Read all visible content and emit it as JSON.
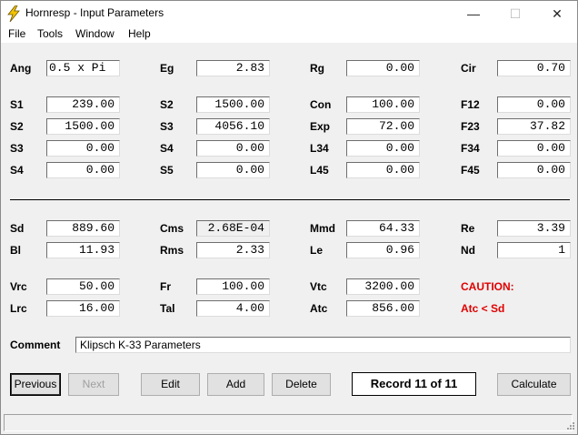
{
  "window": {
    "title": "Hornresp - Input Parameters",
    "controls": {
      "minimize": "—",
      "maximize": "☐",
      "close": "✕"
    }
  },
  "menu": [
    "File",
    "Tools",
    "Window",
    "Help"
  ],
  "labels": {
    "ang": "Ang",
    "eg": "Eg",
    "rg": "Rg",
    "cir": "Cir",
    "s1": "S1",
    "s2a": "S2",
    "con": "Con",
    "f12": "F12",
    "s2b": "S2",
    "s3a": "S3",
    "exp": "Exp",
    "f23": "F23",
    "s3b": "S3",
    "s4a": "S4",
    "l34": "L34",
    "f34": "F34",
    "s4b": "S4",
    "s5": "S5",
    "l45": "L45",
    "f45": "F45",
    "sd": "Sd",
    "cms": "Cms",
    "mmd": "Mmd",
    "re": "Re",
    "bl": "Bl",
    "rms": "Rms",
    "le": "Le",
    "nd": "Nd",
    "vrc": "Vrc",
    "fr": "Fr",
    "vtc": "Vtc",
    "lrc": "Lrc",
    "tal": "Tal",
    "atc": "Atc",
    "comment": "Comment"
  },
  "values": {
    "ang": "0.5 x Pi",
    "eg": "2.83",
    "rg": "0.00",
    "cir": "0.70",
    "s1": "239.00",
    "s2a": "1500.00",
    "con": "100.00",
    "f12": "0.00",
    "s2b": "1500.00",
    "s3a": "4056.10",
    "exp": "72.00",
    "f23": "37.82",
    "s3b": "0.00",
    "s4a": "0.00",
    "l34": "0.00",
    "f34": "0.00",
    "s4b": "0.00",
    "s5": "0.00",
    "l45": "0.00",
    "f45": "0.00",
    "sd": "889.60",
    "cms": "2.68E-04",
    "mmd": "64.33",
    "re": "3.39",
    "bl": "11.93",
    "rms": "2.33",
    "le": "0.96",
    "nd": "1",
    "vrc": "50.00",
    "fr": "100.00",
    "vtc": "3200.00",
    "lrc": "16.00",
    "tal": "4.00",
    "atc": "856.00"
  },
  "caution": {
    "title": "CAUTION:",
    "message": "Atc < Sd"
  },
  "comment": "Klipsch K-33 Parameters",
  "buttons": {
    "previous": "Previous",
    "next": "Next",
    "edit": "Edit",
    "add": "Add",
    "delete": "Delete",
    "calculate": "Calculate"
  },
  "record": "Record 11 of 11",
  "colors": {
    "caution": "#e00000",
    "app_icon": "#f2c400"
  }
}
